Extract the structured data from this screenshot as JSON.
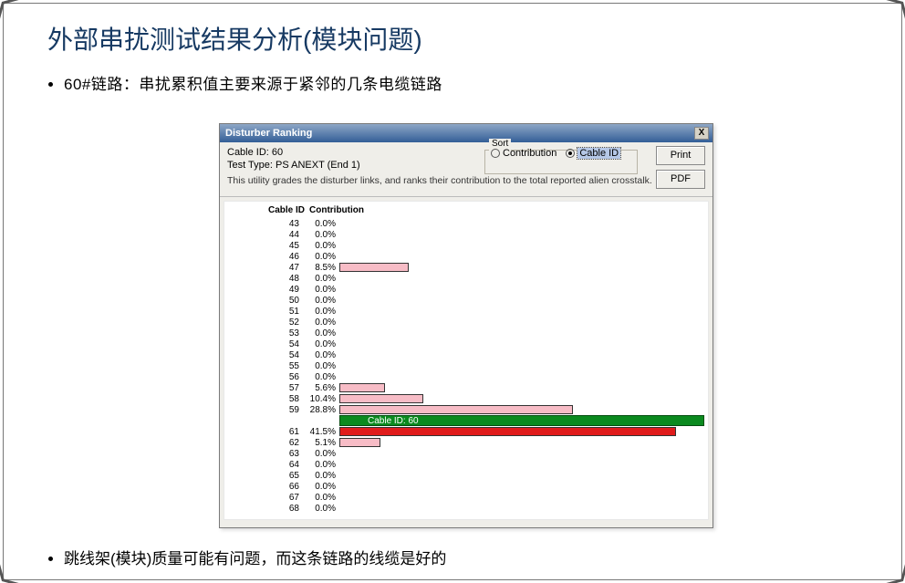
{
  "slide": {
    "title": "外部串扰测试结果分析(模块问题)",
    "bullet1": "60#链路：串扰累积值主要来源于紧邻的几条电缆链路",
    "bullet2": "跳线架(模块)质量可能有问题，而这条链路的线缆是好的"
  },
  "dialog": {
    "title": "Disturber Ranking",
    "close_x": "X",
    "cable_id_label": "Cable ID: 60",
    "test_type_label": "Test Type: PS ANEXT (End 1)",
    "sort_legend": "Sort",
    "sort_contribution": "Contribution",
    "sort_cableid": "Cable ID",
    "print_btn": "Print",
    "pdf_btn": "PDF",
    "description": "This utility grades the disturber links, and ranks their contribution to the total reported alien crosstalk.",
    "col_cableid": "Cable ID",
    "col_contribution": "Contribution",
    "highlight_label": "Cable ID: 60"
  },
  "chart_data": {
    "type": "bar",
    "xlabel": "Contribution",
    "ylabel": "Cable ID",
    "title": "Disturber Ranking",
    "highlight_id": 60,
    "highlight_color": "#0b8a1f",
    "series_colors": {
      "pink": "#f7bcc6",
      "red": "#e01b1b"
    },
    "rows": [
      {
        "id": 43,
        "value": 0.0,
        "color": "pink"
      },
      {
        "id": 44,
        "value": 0.0,
        "color": "pink"
      },
      {
        "id": 45,
        "value": 0.0,
        "color": "pink"
      },
      {
        "id": 46,
        "value": 0.0,
        "color": "pink"
      },
      {
        "id": 47,
        "value": 8.5,
        "color": "pink"
      },
      {
        "id": 48,
        "value": 0.0,
        "color": "pink"
      },
      {
        "id": 49,
        "value": 0.0,
        "color": "pink"
      },
      {
        "id": 50,
        "value": 0.0,
        "color": "pink"
      },
      {
        "id": 51,
        "value": 0.0,
        "color": "pink"
      },
      {
        "id": 52,
        "value": 0.0,
        "color": "pink"
      },
      {
        "id": 53,
        "value": 0.0,
        "color": "pink"
      },
      {
        "id": 54,
        "value": 0.0,
        "color": "pink"
      },
      {
        "id": 54,
        "value": 0.0,
        "color": "pink"
      },
      {
        "id": 55,
        "value": 0.0,
        "color": "pink"
      },
      {
        "id": 56,
        "value": 0.0,
        "color": "pink"
      },
      {
        "id": 57,
        "value": 5.6,
        "color": "pink"
      },
      {
        "id": 58,
        "value": 10.4,
        "color": "pink"
      },
      {
        "id": 59,
        "value": 28.8,
        "color": "pink"
      },
      {
        "id": "HL",
        "value": null,
        "color": "green"
      },
      {
        "id": 61,
        "value": 41.5,
        "color": "red"
      },
      {
        "id": 62,
        "value": 5.1,
        "color": "pink"
      },
      {
        "id": 63,
        "value": 0.0,
        "color": "pink"
      },
      {
        "id": 64,
        "value": 0.0,
        "color": "pink"
      },
      {
        "id": 65,
        "value": 0.0,
        "color": "pink"
      },
      {
        "id": 66,
        "value": 0.0,
        "color": "pink"
      },
      {
        "id": 67,
        "value": 0.0,
        "color": "pink"
      },
      {
        "id": 68,
        "value": 0.0,
        "color": "pink"
      }
    ]
  }
}
